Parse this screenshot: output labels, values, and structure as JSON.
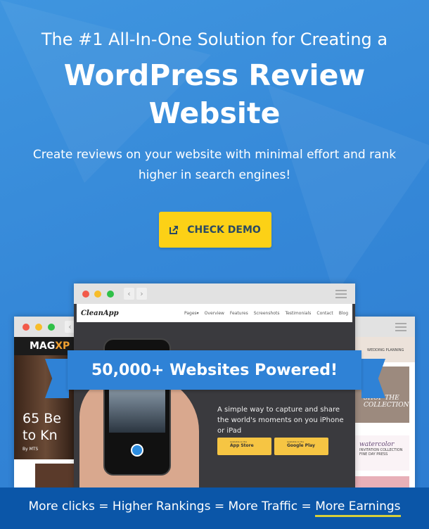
{
  "headline": {
    "line1": "The #1 All-In-One Solution for Creating a",
    "line2": "WordPress Review",
    "line3": "Website"
  },
  "subtitle": "Create reviews on your website with minimal effort and rank higher in search engines!",
  "cta": {
    "label": "CHECK DEMO",
    "icon": "external-link-icon"
  },
  "center_browser": {
    "logo": "CleanApp",
    "nav": [
      "Pages▾",
      "Overview",
      "Features",
      "Screenshots",
      "Testimonials",
      "Contact",
      "Blog"
    ],
    "tagline": "A simple way to capture and share the world's moments on you iPhone or iPad",
    "stores": [
      {
        "small": "Available on the",
        "label": "App Store"
      },
      {
        "small": "Available on the",
        "label": "Google Play"
      }
    ]
  },
  "left_browser": {
    "logo_a": "MAG",
    "logo_b": "XP",
    "headline": "65 Be to Kn",
    "meta": "By MTS"
  },
  "right_browser": {
    "header": "WEDDING PLANNING",
    "banner": "SHOP THE COLLECTION",
    "card_title": "watercolor",
    "card_sub": "INVITATION COLLECTION",
    "card_by": "FINE DAY PRESS"
  },
  "ribbon": "50,000+ Websites Powered!",
  "footer": {
    "text": "More clicks = Higher Rankings = More Traffic = ",
    "highlight": "More Earnings"
  },
  "colors": {
    "background": "#3588d8",
    "cta": "#fcd116",
    "footer": "#0b56a8",
    "ribbon": "#2f82d6",
    "underline": "#d7cf3a"
  }
}
